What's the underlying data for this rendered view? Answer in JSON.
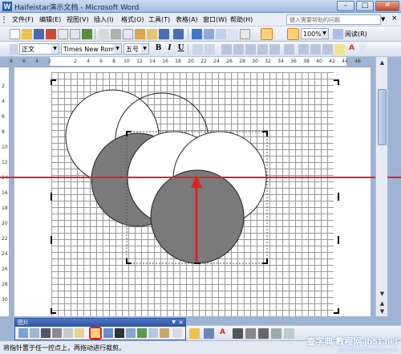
{
  "window": {
    "title": "Haifeistar演示文档 - Microsoft Word",
    "app_icon": "W"
  },
  "menu": {
    "items": [
      "文件(F)",
      "编辑(E)",
      "视图(V)",
      "插入(I)",
      "格式(O)",
      "工具(T)",
      "表格(A)",
      "窗口(W)",
      "帮助(H)"
    ],
    "help_placeholder": "键入需要帮助的问题",
    "close_glyph": "×"
  },
  "toolbar": {
    "zoom": "100%",
    "read_label": "阅读(R)",
    "style": "正文",
    "font": "Times New Roman",
    "size": "五号",
    "bold": "B",
    "italic": "I",
    "underline": "U",
    "font_color_glyph": "A"
  },
  "ruler": {
    "h_ticks": [
      "8",
      "6",
      "4",
      "2",
      "",
      "2",
      "4",
      "6",
      "8",
      "10",
      "12",
      "14",
      "16",
      "18",
      "20",
      "22",
      "24",
      "26",
      "28",
      "30",
      "32",
      "34",
      "36",
      "38",
      "40",
      "42",
      "44",
      "46"
    ],
    "v_ticks": [
      "2",
      "4",
      "6",
      "8",
      "10",
      "12",
      "14",
      "16",
      "18",
      "20",
      "22",
      "24",
      "26",
      "28",
      "30"
    ]
  },
  "picture_toolbar": {
    "title": "图片",
    "close_glyph": "×",
    "drop_glyph": "▼"
  },
  "statusbar": {
    "text": "将指针置于任一控点上，再拖动进行裁剪。"
  },
  "watermark": {
    "line1": "查字典 教程网 jb51.net",
    "line2": "jiaocheng.chazidian.com"
  },
  "colors": {
    "accent": "#e22020",
    "title_bar": "#9fbbe0",
    "circle_fill": "#7a7a7a",
    "highlight": "#ffd27a"
  }
}
